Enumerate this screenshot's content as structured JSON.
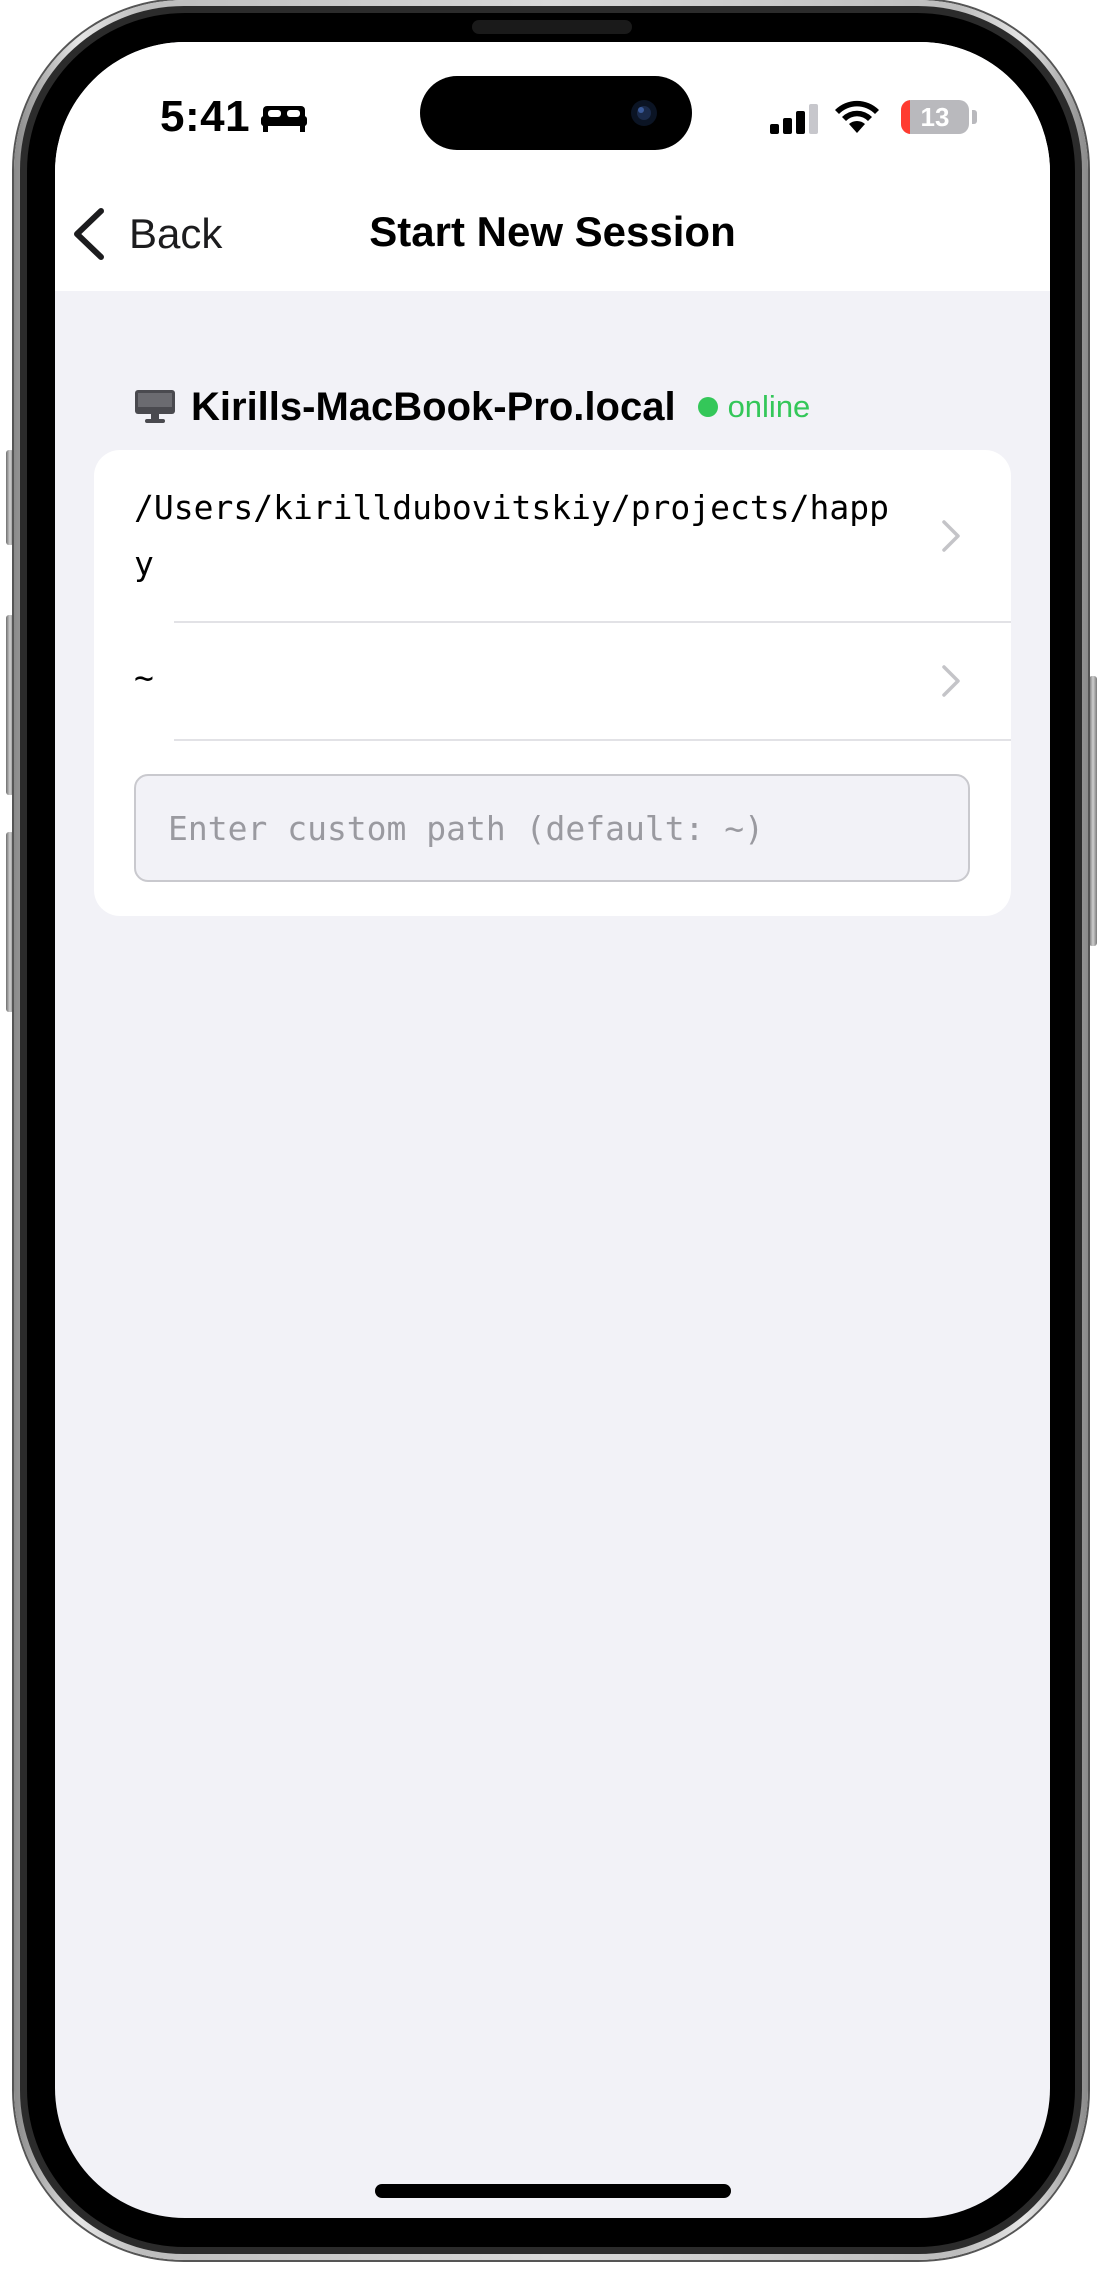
{
  "status_bar": {
    "time": "5:41",
    "focus_icon": "bed-icon",
    "battery_level": "13",
    "battery_fraction": 0.13,
    "icons": [
      "signal-icon",
      "wifi-icon",
      "battery-icon"
    ]
  },
  "nav": {
    "back_label": "Back",
    "title": "Start New Session"
  },
  "machine": {
    "icon": "monitor-icon",
    "name": "Kirills-MacBook-Pro.local",
    "status": "online",
    "status_color": "#34c759"
  },
  "paths": [
    {
      "path": "/Users/kirilldubovitskiy/projects/happy"
    },
    {
      "path": "~"
    }
  ],
  "custom_path": {
    "placeholder": "Enter custom path (default: ~)",
    "value": ""
  },
  "colors": {
    "background": "#f2f2f7",
    "card": "#ffffff",
    "accent_online": "#34c759",
    "battery_low": "#ff3b30"
  }
}
